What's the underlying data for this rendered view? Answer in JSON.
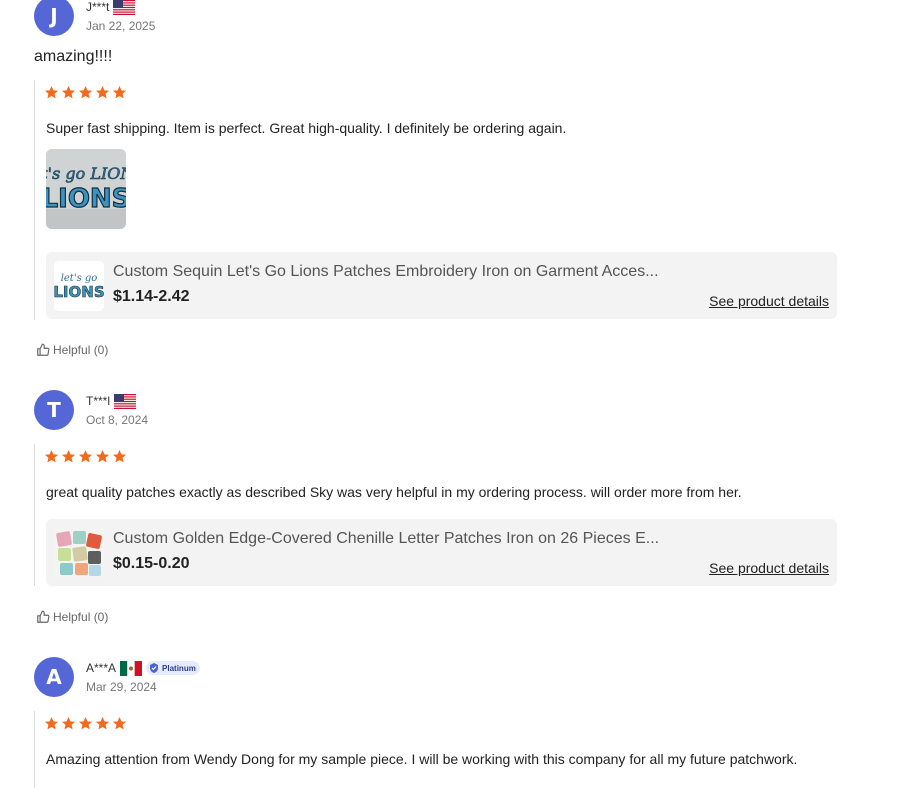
{
  "reviews": [
    {
      "initial": "J",
      "name": "J***t",
      "country_flag": "us-flag-icon",
      "date": "Jan 22, 2025",
      "title": "amazing!!!!",
      "rating": 5,
      "comment": "Super fast shipping. Item is perfect. Great high-quality. I definitely be ordering again.",
      "photo_text": "let's go LIONS",
      "product": {
        "title": "Custom Sequin Let's Go Lions Patches Embroidery Iron on Garment Acces...",
        "price": "$1.14-2.42",
        "details_label": "See product details",
        "thumb_text": "let's go LIONS"
      },
      "helpful": "Helpful (0)"
    },
    {
      "initial": "T",
      "name": "T***l",
      "country_flag": "us-flag-icon",
      "date": "Oct 8, 2024",
      "rating": 5,
      "comment": "great quality patches exactly as described Sky was very helpful in my ordering process. will order more from her.",
      "product": {
        "title": "Custom Golden Edge-Covered Chenille Letter Patches Iron on 26 Pieces E...",
        "price": "$0.15-0.20",
        "details_label": "See product details"
      },
      "helpful": "Helpful (0)"
    },
    {
      "initial": "A",
      "name": "A***A",
      "country_flag": "mx-flag-icon",
      "badge": "Platinum",
      "date": "Mar 29, 2024",
      "rating": 5,
      "comment": "Amazing attention from Wendy Dong for my sample piece. I will be working with this company for all my future patchwork."
    }
  ],
  "colors": {
    "avatar": "#5566d6",
    "star": "#f26b1d",
    "card_bg": "#f3f3f3"
  }
}
